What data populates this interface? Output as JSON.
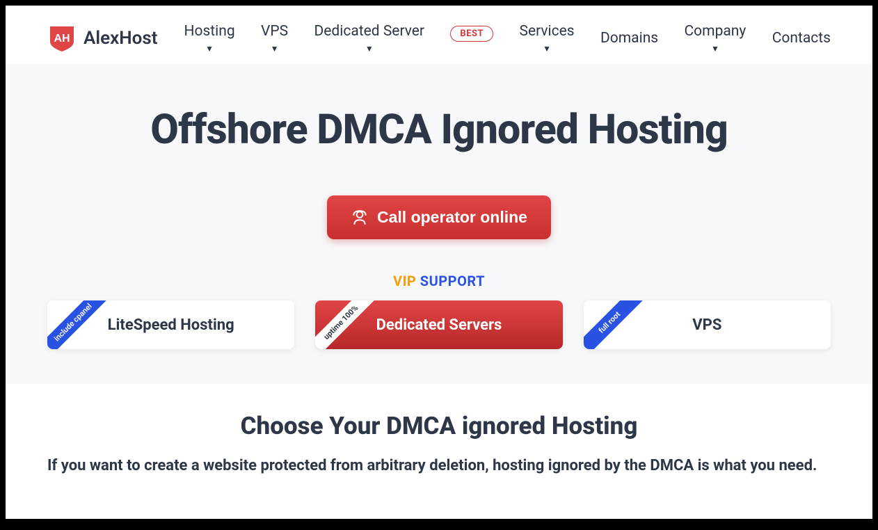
{
  "brand": {
    "name": "AlexHost"
  },
  "nav": {
    "hosting": "Hosting",
    "vps": "VPS",
    "dedicated": "Dedicated Server",
    "badge_best": "BEST",
    "services": "Services",
    "domains": "Domains",
    "company": "Company",
    "contacts": "Contacts"
  },
  "hero": {
    "title": "Offshore DMCA Ignored Hosting",
    "cta": "Call operator online",
    "vip": "VIP",
    "support": "SUPPORT"
  },
  "cards": {
    "litespeed": {
      "label": "LiteSpeed Hosting",
      "ribbon": "include cpanel"
    },
    "dedicated": {
      "label": "Dedicated Servers",
      "ribbon": "uptime 100%"
    },
    "vps": {
      "label": "VPS",
      "ribbon": "full root"
    }
  },
  "section": {
    "title": "Choose Your DMCA ignored Hosting",
    "subtitle": "If you want to create a website protected from arbitrary deletion, hosting ignored by the DMCA is what you need."
  }
}
